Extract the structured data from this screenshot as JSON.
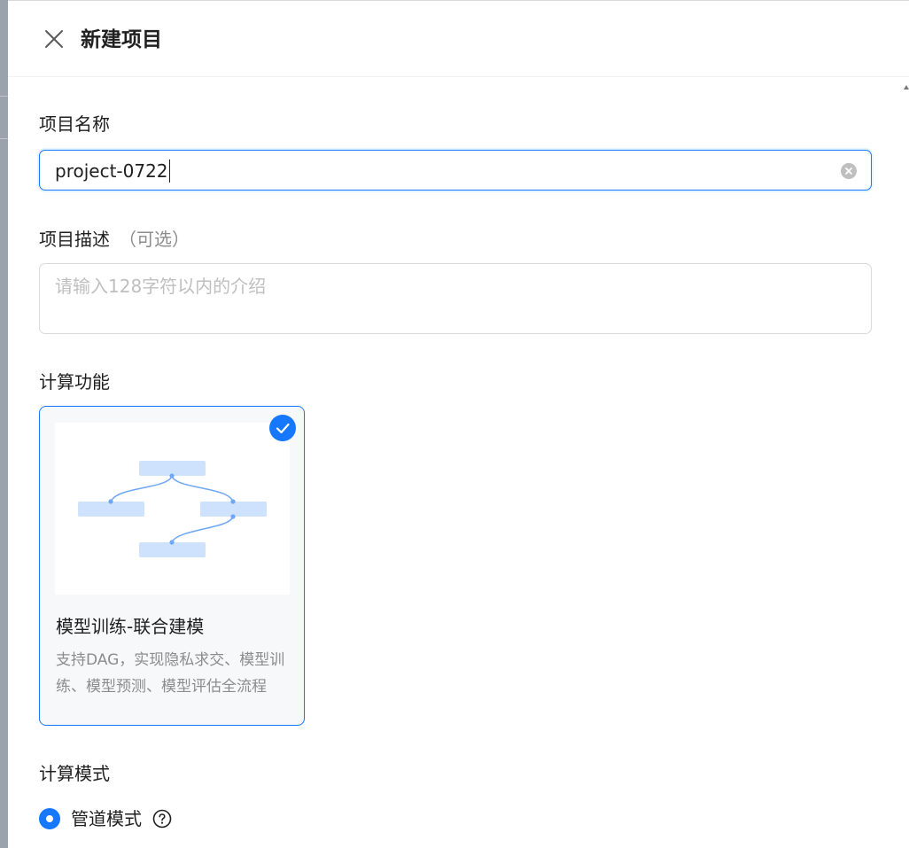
{
  "header": {
    "title": "新建项目",
    "close_icon": "close-icon"
  },
  "form": {
    "name": {
      "label": "项目名称",
      "value": "project-0722",
      "clear_icon": "clear-circle-icon"
    },
    "description": {
      "label": "项目描述",
      "optional": "（可选）",
      "placeholder": "请输入128字符以内的介绍",
      "value": ""
    },
    "compute_function": {
      "label": "计算功能",
      "cards": [
        {
          "title": "模型训练-联合建模",
          "description": "支持DAG，实现隐私求交、模型训练、模型预测、模型评估全流程",
          "selected": true,
          "check_icon": "check-circle-icon",
          "preview_icon": "dag-flow-icon"
        }
      ]
    },
    "compute_mode": {
      "label": "计算模式",
      "options": [
        {
          "label": "管道模式",
          "selected": true,
          "help_icon": "question-circle-icon"
        }
      ]
    }
  },
  "colors": {
    "primary": "#1677ff",
    "border": "#d9d9d9",
    "text": "#1f1f1f",
    "secondary_text": "#8c8c8c",
    "placeholder": "#bfbfbf",
    "card_bg": "#f6f8fa",
    "dag_node": "#cfe2fd",
    "dag_edge": "#6ea7f5"
  }
}
